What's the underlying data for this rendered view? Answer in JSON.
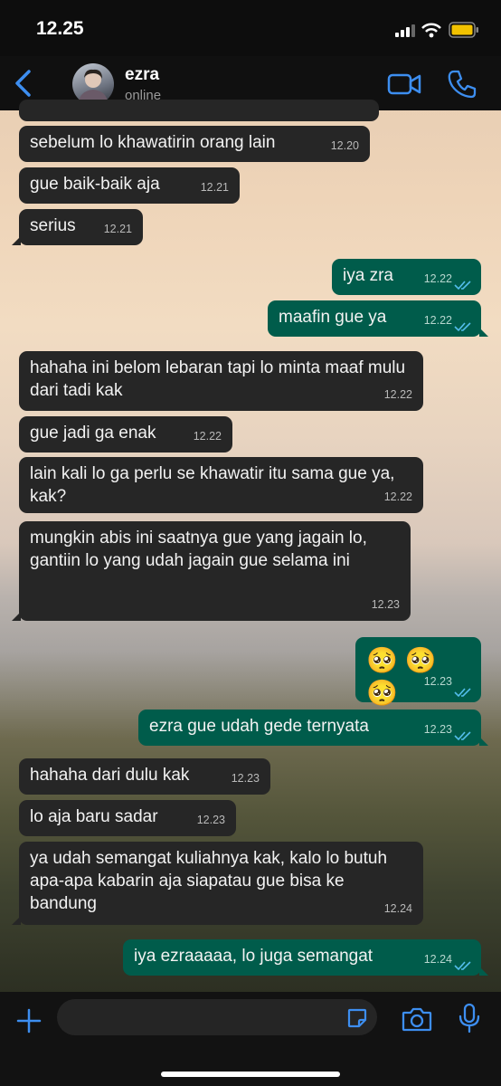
{
  "status_bar": {
    "time": "12.25"
  },
  "header": {
    "contact_name": "ezra",
    "contact_status": "online"
  },
  "messages": [
    {
      "direction": "in",
      "text": "sebelum lo khawatirin orang lain",
      "time": "12.20"
    },
    {
      "direction": "in",
      "text": "gue baik-baik aja",
      "time": "12.21"
    },
    {
      "direction": "in",
      "text": "serius",
      "time": "12.21"
    },
    {
      "direction": "out",
      "text": "iya zra",
      "time": "12.22",
      "read": true
    },
    {
      "direction": "out",
      "text": "maafin gue ya",
      "time": "12.22",
      "read": true
    },
    {
      "direction": "in",
      "text": "hahaha ini belom lebaran tapi lo minta maaf mulu dari tadi kak",
      "time": "12.22"
    },
    {
      "direction": "in",
      "text": "gue jadi ga enak",
      "time": "12.22"
    },
    {
      "direction": "in",
      "text": "lain kali lo ga perlu se khawatir itu sama gue ya, kak?",
      "time": "12.22"
    },
    {
      "direction": "in",
      "text": "mungkin abis ini saatnya gue yang jagain lo, gantiin lo yang udah jagain gue selama ini",
      "time": "12.23"
    },
    {
      "direction": "out",
      "text": "🥺 🥺 🥺",
      "time": "12.23",
      "read": true
    },
    {
      "direction": "out",
      "text": "ezra gue udah gede ternyata",
      "time": "12.23",
      "read": true
    },
    {
      "direction": "in",
      "text": "hahaha dari dulu kak",
      "time": "12.23"
    },
    {
      "direction": "in",
      "text": "lo aja baru sadar",
      "time": "12.23"
    },
    {
      "direction": "in",
      "text": "ya udah semangat kuliahnya kak, kalo lo butuh apa-apa kabarin aja siapatau gue bisa ke bandung",
      "time": "12.24"
    },
    {
      "direction": "out",
      "text": "iya ezraaaaa, lo juga semangat",
      "time": "12.24",
      "read": true
    }
  ],
  "input": {
    "value": "",
    "placeholder": ""
  },
  "colors": {
    "incoming": "#262626",
    "outgoing": "#005c4b",
    "accent": "#3d8ef0"
  }
}
